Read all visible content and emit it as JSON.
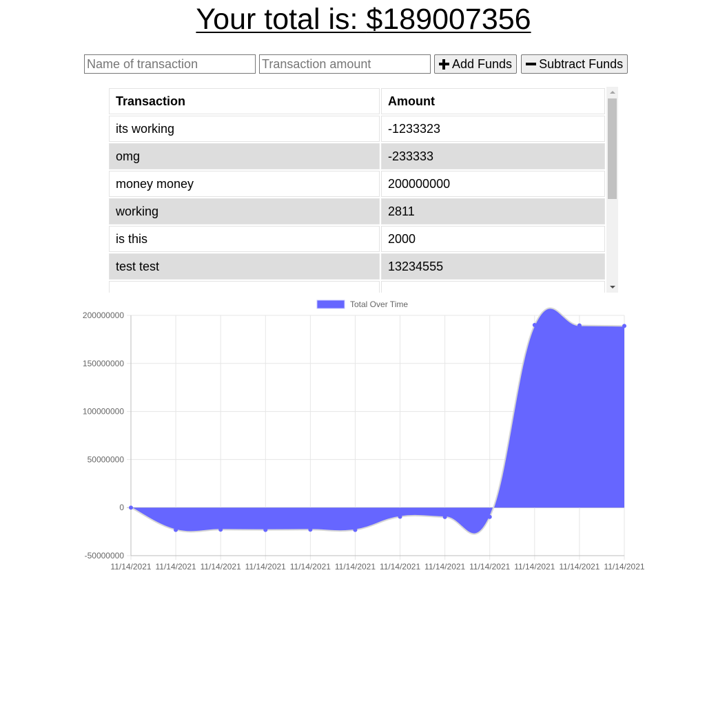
{
  "header": {
    "total_prefix": "Your total is: ",
    "total_value": "$189007356"
  },
  "form": {
    "name_placeholder": "Name of transaction",
    "amount_placeholder": "Transaction amount",
    "add_label": "Add Funds",
    "subtract_label": "Subtract Funds",
    "add_icon": "plus-icon",
    "subtract_icon": "minus-icon"
  },
  "table": {
    "headers": [
      "Transaction",
      "Amount"
    ],
    "rows": [
      {
        "name": "its working",
        "amount": "-1233323"
      },
      {
        "name": "omg",
        "amount": "-233333"
      },
      {
        "name": "money money",
        "amount": "200000000"
      },
      {
        "name": "working",
        "amount": "2811"
      },
      {
        "name": "is this",
        "amount": "2000"
      },
      {
        "name": "test test",
        "amount": "13234555"
      }
    ]
  },
  "colors": {
    "fill": "#6666ff",
    "point": "#6666ff",
    "line": "#d6d6d6",
    "grid": "#e6e6e6",
    "row_alt": "#dddddd"
  },
  "chart_data": {
    "type": "area",
    "legend": "Total Over Time",
    "legend_position": "top",
    "x": [
      "11/14/2021",
      "11/14/2021",
      "11/14/2021",
      "11/14/2021",
      "11/14/2021",
      "11/14/2021",
      "11/14/2021",
      "11/14/2021",
      "11/14/2021",
      "11/14/2021",
      "11/14/2021",
      "11/14/2021"
    ],
    "series": [
      {
        "name": "Total Over Time",
        "values": [
          0,
          -23200000,
          -23000000,
          -23200000,
          -23000000,
          -23200000,
          -9500000,
          -9800000,
          -9700000,
          190000000,
          189500000,
          189007356
        ]
      }
    ],
    "ylim": [
      -50000000,
      200000000
    ],
    "yticks": [
      200000000,
      150000000,
      100000000,
      50000000,
      0,
      -50000000
    ],
    "grid": true
  }
}
